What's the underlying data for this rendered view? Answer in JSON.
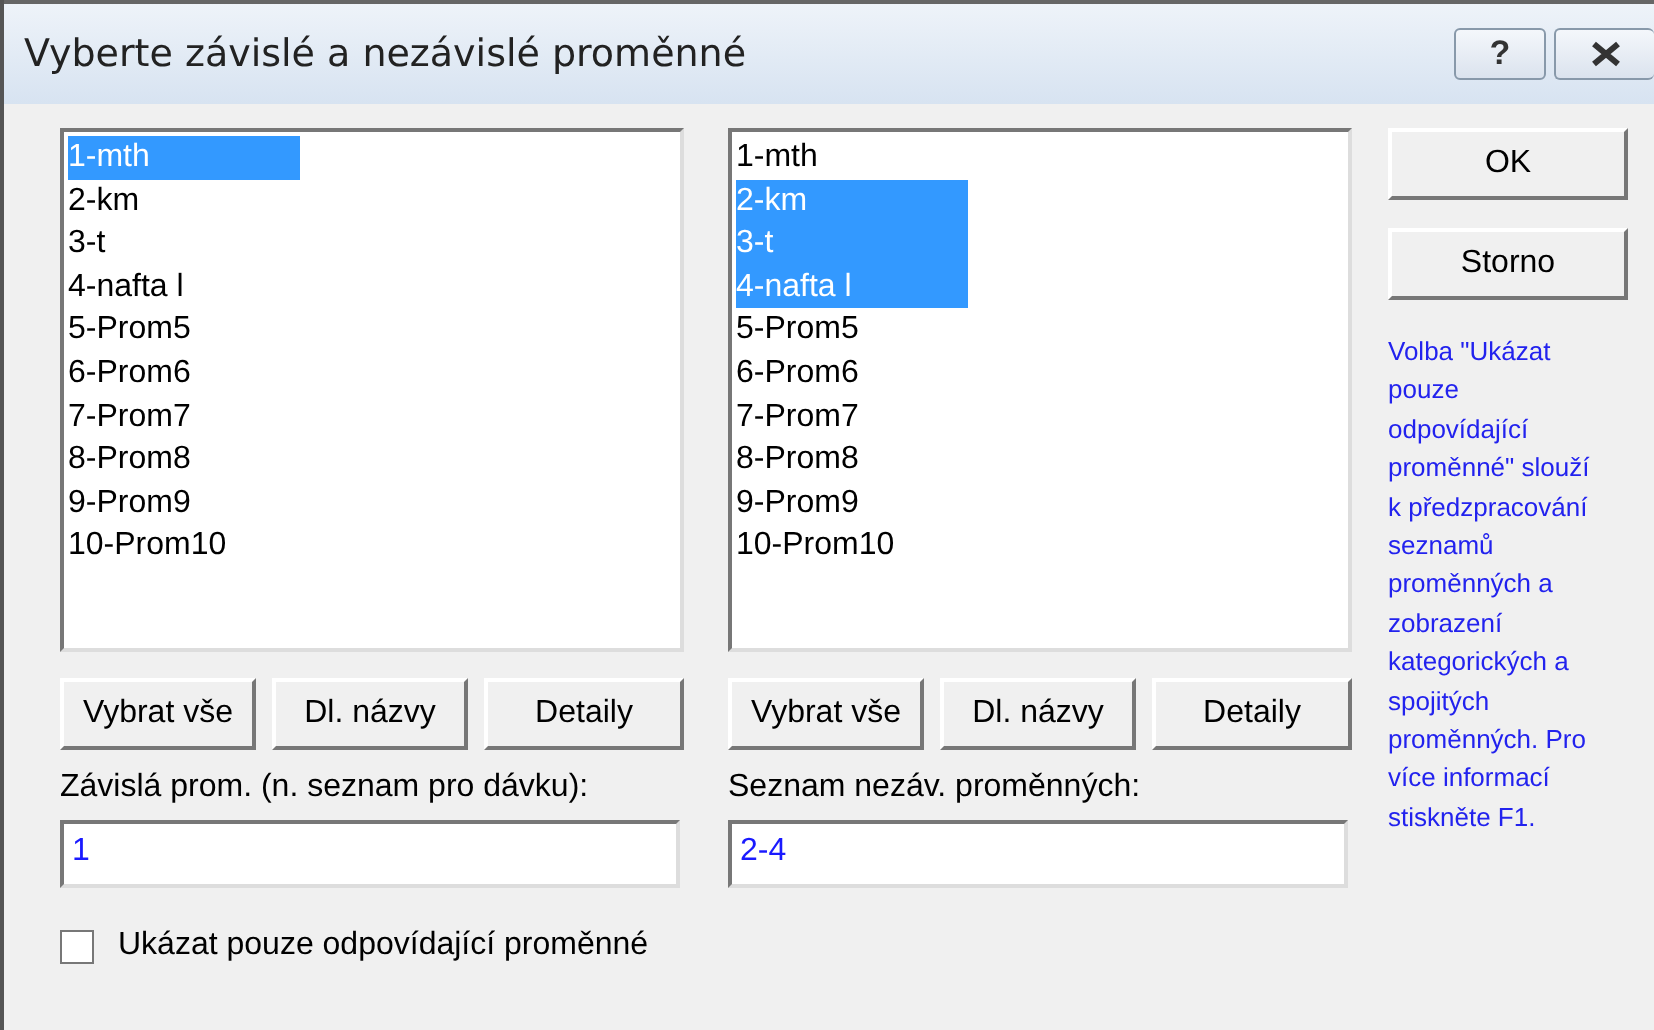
{
  "window": {
    "title": "Vyberte závislé a nezávislé proměnné",
    "help_button": "?"
  },
  "lists": [
    {
      "items": [
        {
          "label": "1-mth",
          "selected": true
        },
        {
          "label": "2-km",
          "selected": false
        },
        {
          "label": "3-t",
          "selected": false
        },
        {
          "label": "4-nafta l",
          "selected": false
        },
        {
          "label": "5-Prom5",
          "selected": false
        },
        {
          "label": "6-Prom6",
          "selected": false
        },
        {
          "label": "7-Prom7",
          "selected": false
        },
        {
          "label": "8-Prom8",
          "selected": false
        },
        {
          "label": "9-Prom9",
          "selected": false
        },
        {
          "label": "10-Prom10",
          "selected": false
        }
      ],
      "buttons": [
        "Vybrat vše",
        "Dl. názvy",
        "Detaily"
      ],
      "field_label": "Závislá prom. (n. seznam pro dávku):",
      "field_value": "1"
    },
    {
      "items": [
        {
          "label": "1-mth",
          "selected": false
        },
        {
          "label": "2-km",
          "selected": true
        },
        {
          "label": "3-t",
          "selected": true
        },
        {
          "label": "4-nafta l",
          "selected": true
        },
        {
          "label": "5-Prom5",
          "selected": false
        },
        {
          "label": "6-Prom6",
          "selected": false
        },
        {
          "label": "7-Prom7",
          "selected": false
        },
        {
          "label": "8-Prom8",
          "selected": false
        },
        {
          "label": "9-Prom9",
          "selected": false
        },
        {
          "label": "10-Prom10",
          "selected": false
        }
      ],
      "buttons": [
        "Vybrat vše",
        "Dl. názvy",
        "Detaily"
      ],
      "field_label": "Seznam nezáv. proměnných:",
      "field_value": "2-4"
    }
  ],
  "side_buttons": [
    "OK",
    "Storno"
  ],
  "help_text": [
    "Volba \"Ukázat",
    "pouze",
    "odpovídající",
    "proměnné\" slouží",
    "k předzpracování",
    "seznamů",
    "proměnných a",
    "zobrazení",
    "kategorických a",
    "spojitých",
    "proměnných. Pro",
    "více informací",
    "stiskněte F1."
  ],
  "checkbox": {
    "label": "Ukázat pouze odpovídající proměnné",
    "checked": false
  }
}
